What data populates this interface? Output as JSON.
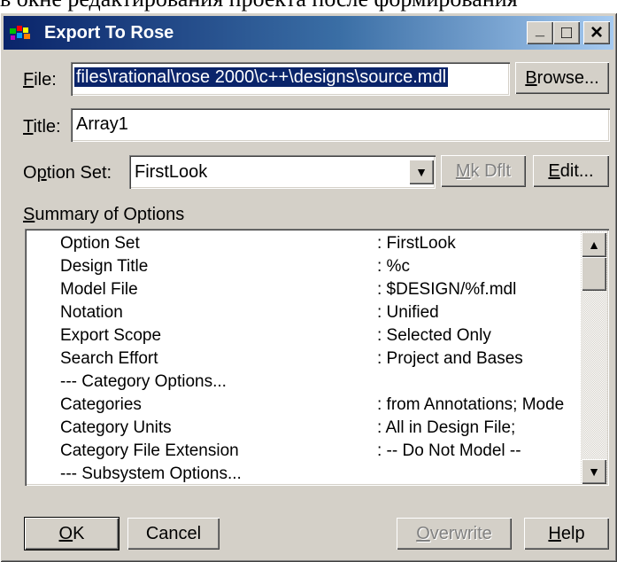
{
  "background_text": "в окне редактирования проекта после формирования",
  "window": {
    "title": "Export To Rose",
    "controls": {
      "minimize": "_",
      "maximize": "□",
      "close": "×"
    }
  },
  "file": {
    "label_key": "F",
    "label_rest": "ile:",
    "value": "files\\rational\\rose 2000\\c++\\designs\\source.mdl",
    "browse_key": "B",
    "browse_rest": "rowse..."
  },
  "title_field": {
    "label_key": "T",
    "label_rest": "itle:",
    "value": "Array1"
  },
  "option_set": {
    "label_pre": "O",
    "label_key": "p",
    "label_rest": "tion Set:",
    "value": "FirstLook",
    "mk_dflt_key": "M",
    "mk_dflt_rest": "k Dflt",
    "edit_key": "E",
    "edit_rest": "dit..."
  },
  "summary": {
    "label_key": "S",
    "label_rest": "ummary of Options",
    "rows": [
      {
        "key": "Option Set",
        "value": ": FirstLook"
      },
      {
        "key": "Design Title",
        "value": ": %c"
      },
      {
        "key": "Model File",
        "value": ": $DESIGN/%f.mdl"
      },
      {
        "key": "Notation",
        "value": ": Unified"
      },
      {
        "key": "Export Scope",
        "value": ": Selected Only"
      },
      {
        "key": "Search Effort",
        "value": ": Project and Bases"
      },
      {
        "key": "--- Category Options...",
        "value": ""
      },
      {
        "key": "Categories",
        "value": ": from Annotations; Mode"
      },
      {
        "key": "Category Units",
        "value": ": All in Design File;"
      },
      {
        "key": "Category File Extension",
        "value": ": -- Do Not Model --"
      },
      {
        "key": "--- Subsystem Options...",
        "value": ""
      }
    ]
  },
  "buttons": {
    "ok_key": "O",
    "ok_rest": "K",
    "cancel": "Cancel",
    "overwrite_key": "O",
    "overwrite_rest": "verwrite",
    "help_key": "H",
    "help_rest": "elp"
  },
  "colors": {
    "title_start": "#0a246a",
    "title_end": "#a6caf0",
    "face": "#d4d0c8",
    "selection": "#0a246a"
  }
}
